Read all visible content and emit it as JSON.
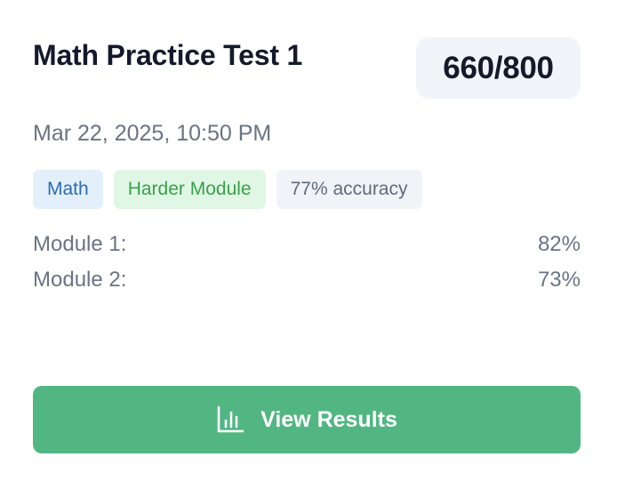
{
  "test": {
    "title": "Math Practice Test 1",
    "score": "660/800",
    "date": "Mar 22, 2025, 10:50 PM"
  },
  "badges": {
    "subject": "Math",
    "module": "Harder Module",
    "accuracy": "77% accuracy"
  },
  "modules": [
    {
      "label": "Module 1:",
      "value": "82%"
    },
    {
      "label": "Module 2:",
      "value": "73%"
    }
  ],
  "actions": {
    "view_results_label": "View Results",
    "view_results_icon": "bar-chart-icon"
  },
  "colors": {
    "button": "#52b682",
    "subject_badge_bg": "#e3f0fb",
    "module_badge_bg": "#e1f7e6",
    "accuracy_badge_bg": "#f0f3f7"
  }
}
